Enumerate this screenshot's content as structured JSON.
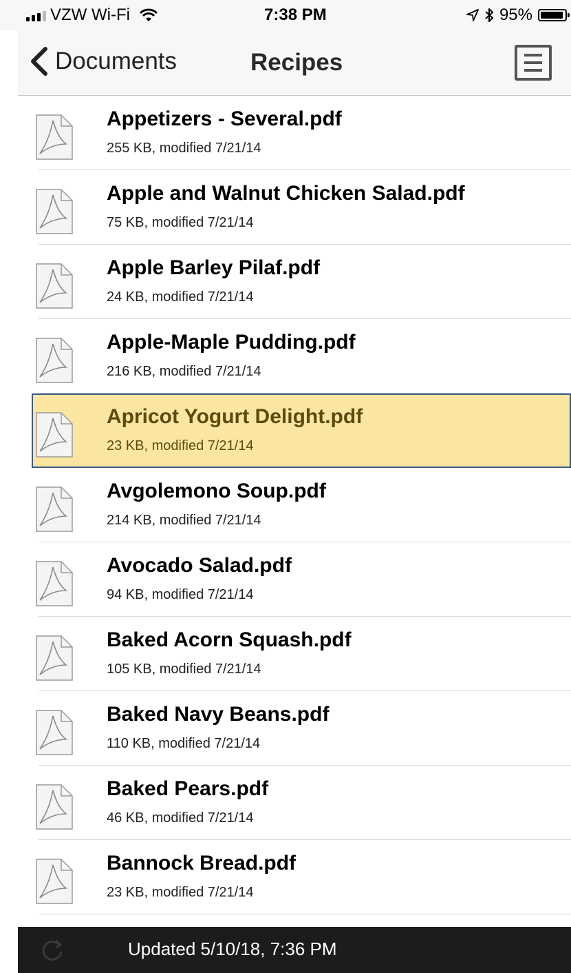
{
  "status_bar": {
    "carrier": "VZW Wi-Fi",
    "time": "7:38 PM",
    "battery": "95%",
    "battery_level": 0.95,
    "icons": [
      "signal-icon",
      "wifi-icon",
      "location-icon",
      "bluetooth-icon",
      "battery-icon"
    ]
  },
  "nav": {
    "back_label": "Documents",
    "title": "Recipes",
    "menu_icon": "list-icon"
  },
  "files": [
    {
      "name": "Appetizers - Several.pdf",
      "meta": "255 KB, modified 7/21/14"
    },
    {
      "name": "Apple and Walnut Chicken Salad.pdf",
      "meta": "75 KB, modified 7/21/14"
    },
    {
      "name": "Apple Barley Pilaf.pdf",
      "meta": "24 KB, modified 7/21/14"
    },
    {
      "name": "Apple-Maple Pudding.pdf",
      "meta": "216 KB, modified 7/21/14"
    },
    {
      "name": "Apricot Yogurt Delight.pdf",
      "meta": "23 KB, modified 7/21/14",
      "selected": true
    },
    {
      "name": "Avgolemono Soup.pdf",
      "meta": "214 KB, modified 7/21/14"
    },
    {
      "name": "Avocado Salad.pdf",
      "meta": "94 KB, modified 7/21/14"
    },
    {
      "name": "Baked Acorn Squash.pdf",
      "meta": "105 KB, modified 7/21/14"
    },
    {
      "name": "Baked Navy Beans.pdf",
      "meta": "110 KB, modified 7/21/14"
    },
    {
      "name": "Baked Pears.pdf",
      "meta": "46 KB, modified 7/21/14"
    },
    {
      "name": "Bannock Bread.pdf",
      "meta": "23 KB, modified 7/21/14"
    }
  ],
  "bottom_bar": {
    "updated_text": "Updated 5/10/18, 7:36 PM",
    "refresh_icon": "refresh-icon"
  },
  "colors": {
    "selected_background": "#fbe6a1",
    "selected_outline": "#3b5a86",
    "bottom_bar": "#1c1c1c"
  }
}
